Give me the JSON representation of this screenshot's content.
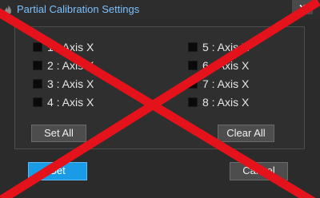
{
  "window": {
    "title": "Partial Calibration Settings",
    "close_label": "×"
  },
  "axes": [
    {
      "label": "1 : Axis X",
      "checked": false
    },
    {
      "label": "2 : Axis X",
      "checked": false
    },
    {
      "label": "3 : Axis X",
      "checked": false
    },
    {
      "label": "4 : Axis X",
      "checked": false
    },
    {
      "label": "5 : Axis X",
      "checked": false
    },
    {
      "label": "6 : Axis X",
      "checked": false
    },
    {
      "label": "7 : Axis X",
      "checked": false
    },
    {
      "label": "8 : Axis X",
      "checked": false
    }
  ],
  "buttons": {
    "set_all": "Set All",
    "clear_all": "Clear All",
    "set": "Set",
    "cancel": "Cancel"
  },
  "colors": {
    "background": "#2b2b2b",
    "title_text": "#7ac1ff",
    "primary_button": "#1a9be6",
    "overlay_cross": "#e3121b"
  },
  "icons": {
    "app": "flame-icon",
    "close": "close-icon"
  }
}
